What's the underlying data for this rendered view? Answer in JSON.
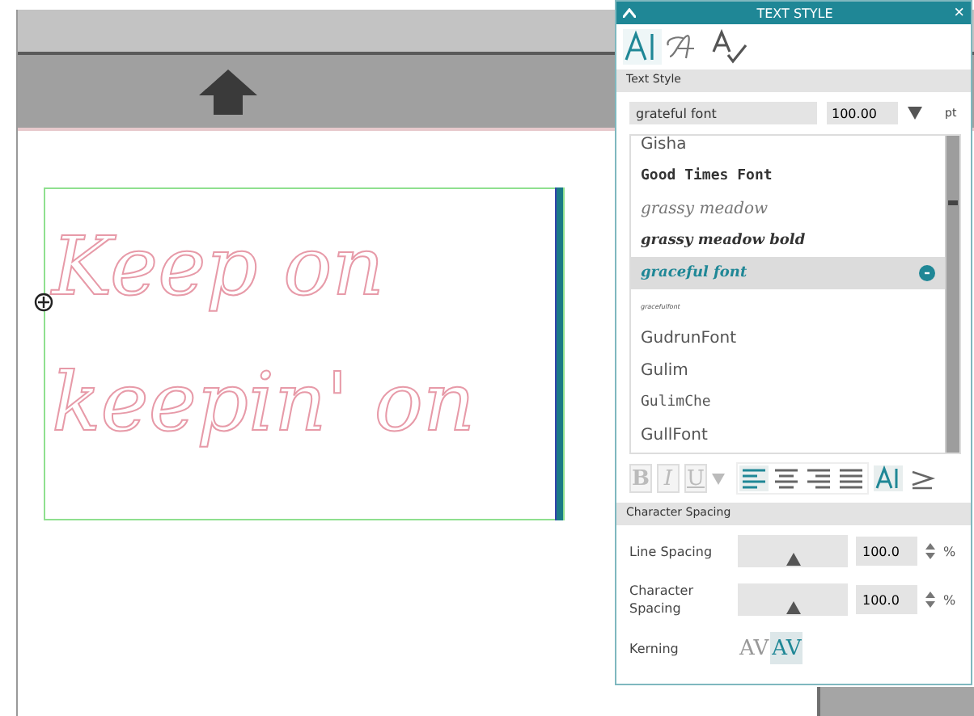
{
  "canvas": {
    "text_lines": [
      "Keep on",
      "keepin' on"
    ]
  },
  "panel": {
    "title": "TEXT STYLE",
    "close": "×",
    "style_tabs": [
      {
        "kind": "text",
        "selected": true
      },
      {
        "kind": "font",
        "selected": false
      },
      {
        "kind": "spell",
        "selected": false
      }
    ],
    "section_title": "Text Style",
    "font_field": {
      "value": "grateful font"
    },
    "size_field": {
      "value": "100.00"
    },
    "size_unit": "pt",
    "fonts": [
      {
        "name": "Gisha",
        "kind": "plain",
        "selected": false,
        "badge": false
      },
      {
        "name": "Good Times Font",
        "kind": "bold",
        "selected": false,
        "badge": false
      },
      {
        "name": "grassy meadow",
        "kind": "script",
        "selected": false,
        "badge": false
      },
      {
        "name": "grassy meadow bold",
        "kind": "boldscript",
        "selected": false,
        "badge": false
      },
      {
        "name": "graceful font",
        "kind": "boldscript",
        "selected": true,
        "badge": true
      },
      {
        "name": "gracefulfont",
        "kind": "tiny",
        "selected": false,
        "badge": false
      },
      {
        "name": "GudrunFont",
        "kind": "plain",
        "selected": false,
        "badge": false
      },
      {
        "name": "Gulim",
        "kind": "plain",
        "selected": false,
        "badge": false
      },
      {
        "name": "GulimChe",
        "kind": "mono",
        "selected": false,
        "badge": false
      },
      {
        "name": "GullFont",
        "kind": "plain",
        "selected": false,
        "badge": false
      }
    ],
    "format_buttons": [
      {
        "label": "B",
        "kind": "bold",
        "selected": false
      },
      {
        "label": "I",
        "kind": "italic",
        "selected": false
      },
      {
        "label": "U",
        "kind": "underline",
        "selected": false
      }
    ],
    "align_buttons": [
      {
        "kind": "left",
        "selected": true
      },
      {
        "kind": "center",
        "selected": false
      },
      {
        "kind": "right",
        "selected": false
      },
      {
        "kind": "justify",
        "selected": false
      }
    ],
    "direction_buttons": [
      {
        "kind": "horizontal",
        "selected": true
      },
      {
        "kind": "vertical",
        "selected": false
      }
    ],
    "spacing_title": "Character Spacing",
    "spacing": [
      {
        "label": "Line Spacing",
        "level": 0.5,
        "value": "100.0",
        "unit": "%"
      },
      {
        "label": "Character Spacing",
        "level": 0.5,
        "value": "100.0",
        "unit": "%"
      }
    ],
    "kerning": {
      "label": "Kerning",
      "options": [
        {
          "label": "AV",
          "selected": false
        },
        {
          "label": "AV",
          "selected": true
        }
      ]
    }
  }
}
